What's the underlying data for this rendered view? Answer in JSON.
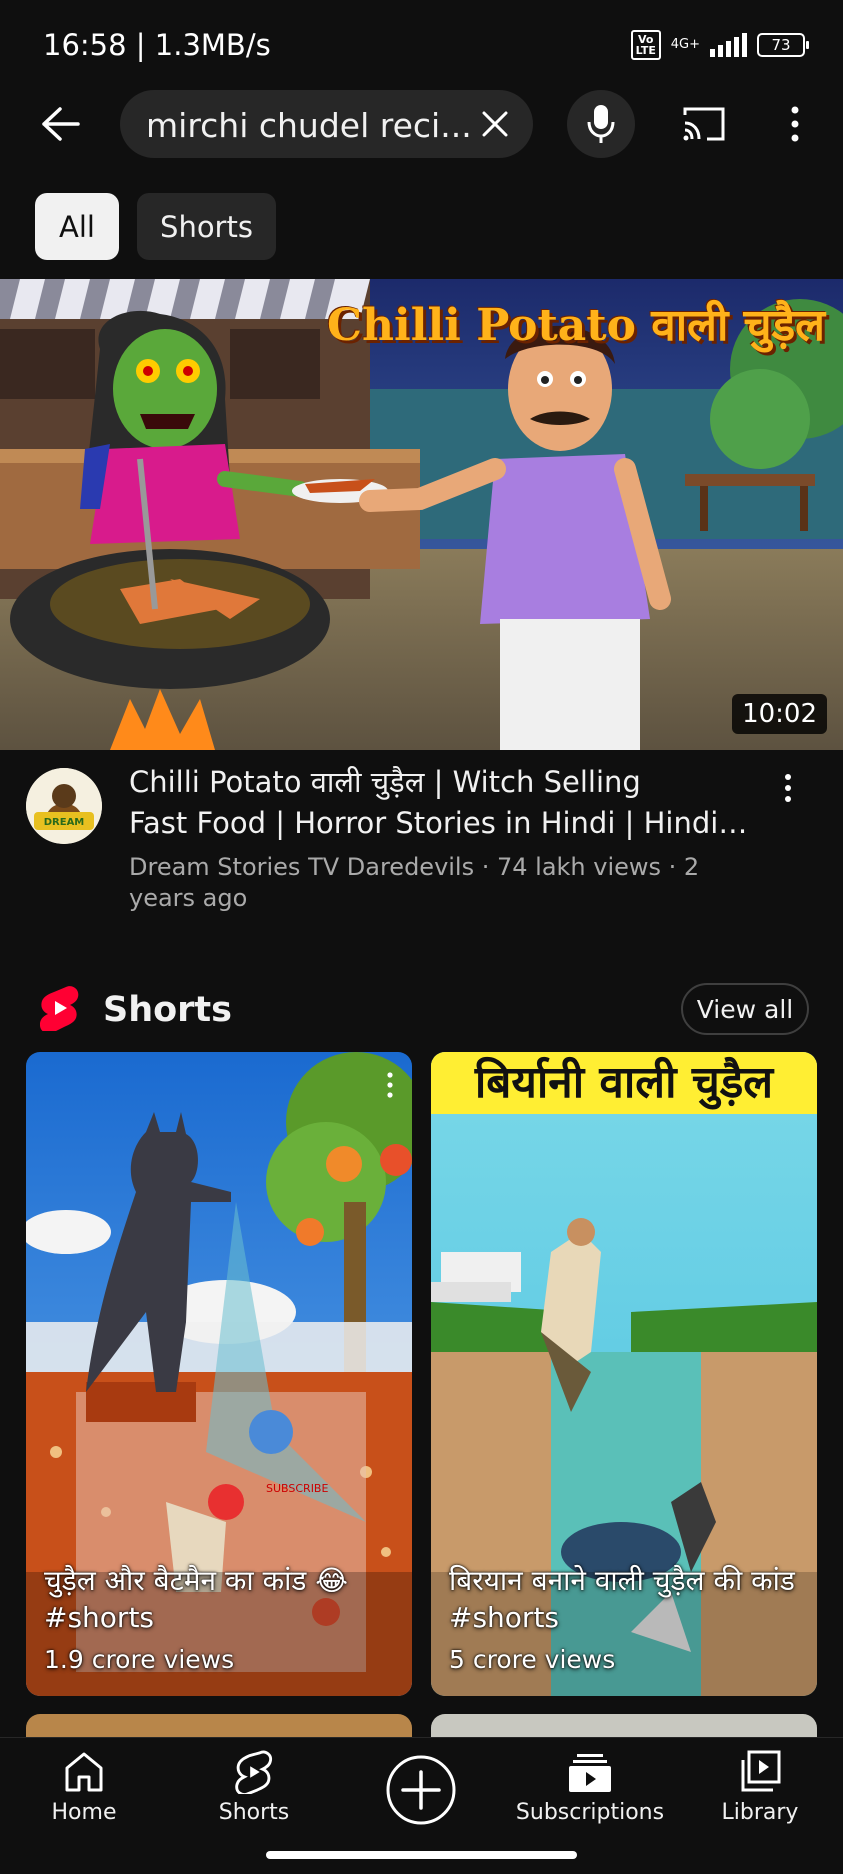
{
  "status_bar": {
    "time": "16:58 | 1.3MB/s",
    "volte": "Vo LTE",
    "network": "4G+",
    "battery": "73"
  },
  "search": {
    "query": "mirchi chudel reci..."
  },
  "chips": [
    {
      "label": "All",
      "selected": true
    },
    {
      "label": "Shorts",
      "selected": false
    }
  ],
  "video": {
    "thumbnail_title": "Chilli Potato वाली चुड़ैल",
    "duration": "10:02",
    "title_line1": "Chilli Potato वाली चुड़ैल | Witch Selling",
    "title_line2": "Fast Food | Horror Stories in Hindi | Hindi K...",
    "meta": "Dream Stories TV Daredevils · 74 lakh views · 2 years ago",
    "avatar_text": "DREAM STORIES"
  },
  "shorts_section": {
    "heading": "Shorts",
    "view_all": "View all",
    "items": [
      {
        "caption": "चुड़ैल और बैटमैन का कांड 😂 #shorts",
        "views": "1.9 crore views",
        "overlay_text": "SUBSCRIBE"
      },
      {
        "caption": "बिरयान बनाने वाली चुड़ैल की कांड #shorts",
        "views": "5 crore views",
        "banner": "बिर्यानी वाली चुड़ैल"
      }
    ]
  },
  "bottom_nav": {
    "items": [
      {
        "label": "Home",
        "icon": "home-icon"
      },
      {
        "label": "Shorts",
        "icon": "shorts-icon"
      },
      {
        "label": "",
        "icon": "create-icon"
      },
      {
        "label": "Subscriptions",
        "icon": "subscriptions-icon"
      },
      {
        "label": "Library",
        "icon": "library-icon"
      }
    ]
  },
  "colors": {
    "background": "#0f0f0f",
    "chip_bg": "#272727",
    "secondary_text": "#aaaaaa",
    "shorts_red": "#ff0033"
  }
}
